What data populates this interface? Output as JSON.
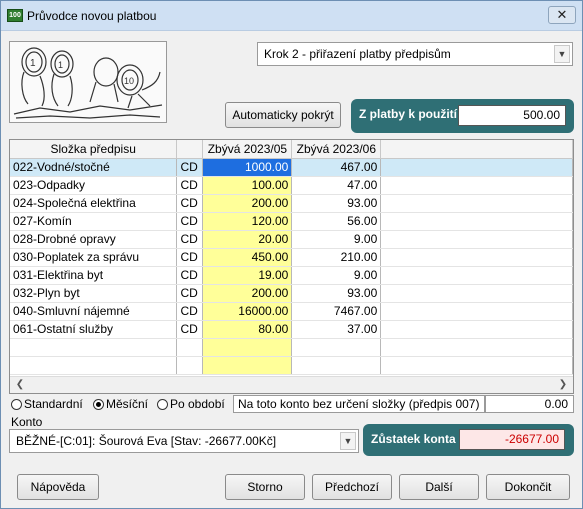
{
  "window": {
    "title": "Průvodce novou platbou",
    "icon_text": "100",
    "close_label": "✕"
  },
  "step": {
    "selected": "Krok 2 - přiřazení platby předpisům"
  },
  "auto_button_label": "Automaticky pokrýt",
  "payment": {
    "label": "Z platby k použití",
    "value": "500.00"
  },
  "table": {
    "headers": [
      "Složka předpisu",
      "",
      "Zbývá 2023/05",
      "Zbývá 2023/06"
    ],
    "rows": [
      {
        "name": "022-Vodné/stočné",
        "code": "CD",
        "col1": "1000.00",
        "col2": "467.00"
      },
      {
        "name": "023-Odpadky",
        "code": "CD",
        "col1": "100.00",
        "col2": "47.00"
      },
      {
        "name": "024-Společná elektřina",
        "code": "CD",
        "col1": "200.00",
        "col2": "93.00"
      },
      {
        "name": "027-Komín",
        "code": "CD",
        "col1": "120.00",
        "col2": "56.00"
      },
      {
        "name": "028-Drobné opravy",
        "code": "CD",
        "col1": "20.00",
        "col2": "9.00"
      },
      {
        "name": "030-Poplatek za správu",
        "code": "CD",
        "col1": "450.00",
        "col2": "210.00"
      },
      {
        "name": "031-Elektřina byt",
        "code": "CD",
        "col1": "19.00",
        "col2": "9.00"
      },
      {
        "name": "032-Plyn byt",
        "code": "CD",
        "col1": "200.00",
        "col2": "93.00"
      },
      {
        "name": "040-Smluvní nájemné",
        "code": "CD",
        "col1": "16000.00",
        "col2": "7467.00"
      },
      {
        "name": "061-Ostatní služby",
        "code": "CD",
        "col1": "80.00",
        "col2": "37.00"
      }
    ],
    "empty_rows": 2
  },
  "view_mode": {
    "options": [
      "Standardní",
      "Měsíční",
      "Po období"
    ],
    "selected": "Měsíční"
  },
  "noncategorized": {
    "label": "Na toto konto bez určení složky (předpis 007)",
    "value": "0.00"
  },
  "konto": {
    "label": "Konto",
    "selected": "BĚŽNÉ-[C:01]: Šourová Eva [Stav: -26677.00Kč]"
  },
  "balance": {
    "label": "Zůstatek konta",
    "value": "-26677.00"
  },
  "buttons": {
    "help": "Nápověda",
    "cancel": "Storno",
    "prev": "Předchozí",
    "next": "Další",
    "finish": "Dokončit"
  }
}
